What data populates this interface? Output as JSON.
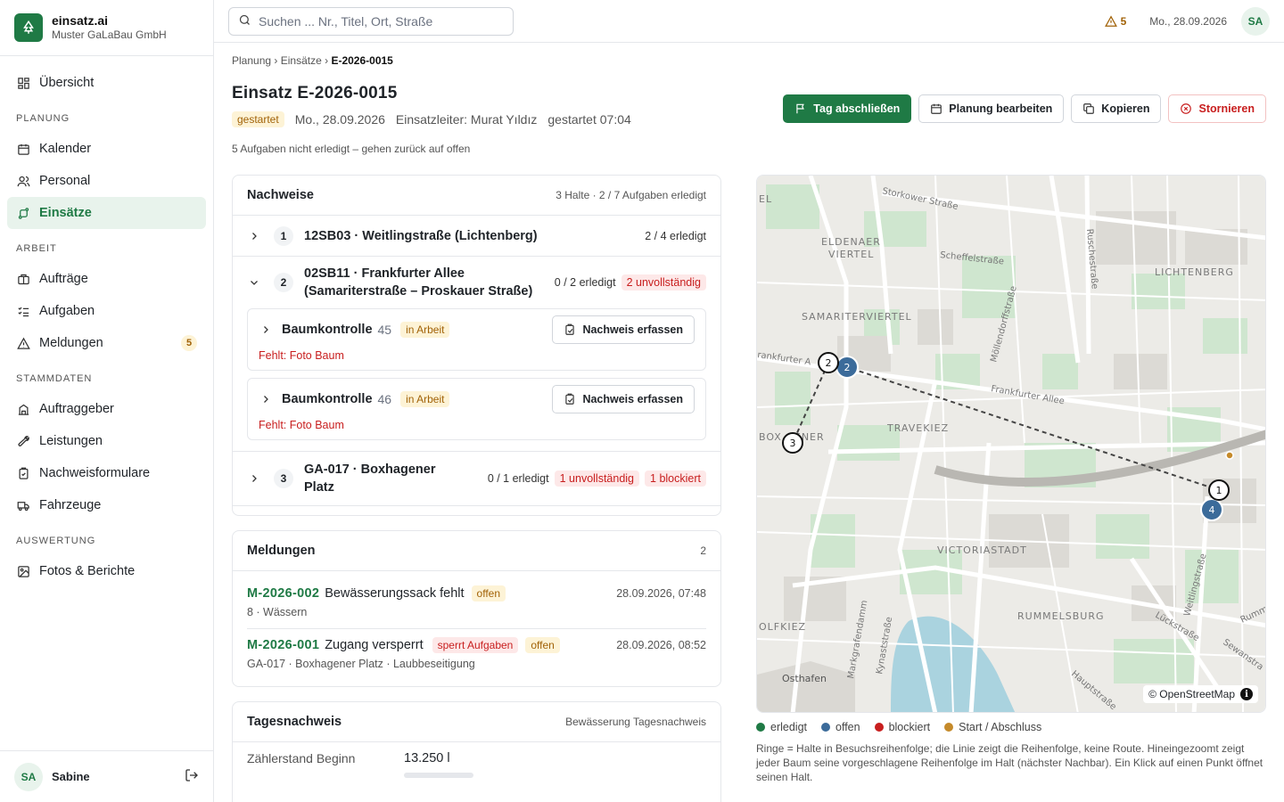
{
  "brand": {
    "name": "einsatz.ai",
    "company": "Muster GaLaBau GmbH"
  },
  "nav": {
    "overview": "Übersicht",
    "section_planung": "PLANUNG",
    "kalender": "Kalender",
    "personal": "Personal",
    "einsaetze": "Einsätze",
    "section_arbeit": "ARBEIT",
    "auftraege": "Aufträge",
    "aufgaben": "Aufgaben",
    "meldungen": "Meldungen",
    "meldungen_badge": "5",
    "section_stamm": "STAMMDATEN",
    "auftraggeber": "Auftraggeber",
    "leistungen": "Leistungen",
    "nachweisformulare": "Nachweisformulare",
    "fahrzeuge": "Fahrzeuge",
    "section_auswertung": "AUSWERTUNG",
    "fotos": "Fotos & Berichte"
  },
  "user": {
    "initials": "SA",
    "name": "Sabine"
  },
  "topbar": {
    "search_placeholder": "Suchen ... Nr., Titel, Ort, Straße",
    "warnings": "5",
    "date": "Mo., 28.09.2026",
    "initials": "SA"
  },
  "breadcrumb": {
    "a": "Planung",
    "b": "Einsätze",
    "c": "E-2026-0015",
    "sep": "›"
  },
  "header": {
    "title": "Einsatz E-2026-0015",
    "status": "gestartet",
    "date": "Mo., 28.09.2026",
    "leader": "Einsatzleiter: Murat Yıldız",
    "started": "gestartet 07:04",
    "note": "5 Aufgaben nicht erledigt – gehen zurück auf offen"
  },
  "actions": {
    "close_day": "Tag abschließen",
    "edit_plan": "Planung bearbeiten",
    "copy": "Kopieren",
    "cancel": "Stornieren"
  },
  "nachweise": {
    "title": "Nachweise",
    "summary": "3 Halte · 2 / 7 Aufgaben erledigt",
    "stops": [
      {
        "num": "1",
        "title": "12SB03 · Weitlingstraße (Lichtenberg)",
        "done": "2 / 4 erledigt"
      },
      {
        "num": "2",
        "title_l1": "02SB11 · Frankfurter Allee",
        "title_l2": "(Samariterstraße – Proskauer Straße)",
        "done": "0 / 2 erledigt",
        "incomplete": "2 unvollständig"
      },
      {
        "num": "3",
        "title_l1": "GA-017 · Boxhagener",
        "title_l2": "Platz",
        "done": "0 / 1 erledigt",
        "incomplete": "1 unvollständig",
        "blocked": "1 blockiert"
      }
    ],
    "tasks": [
      {
        "name": "Baumkontrolle",
        "num": "45",
        "status": "in Arbeit",
        "button": "Nachweis erfassen",
        "missing": "Fehlt: Foto Baum"
      },
      {
        "name": "Baumkontrolle",
        "num": "46",
        "status": "in Arbeit",
        "button": "Nachweis erfassen",
        "missing": "Fehlt: Foto Baum"
      }
    ]
  },
  "meldungen": {
    "title": "Meldungen",
    "count": "2",
    "items": [
      {
        "id": "M-2026-002",
        "text": "Bewässerungssack fehlt",
        "status": "offen",
        "time": "28.09.2026, 07:48",
        "sub": "8 · Wässern"
      },
      {
        "id": "M-2026-001",
        "text": "Zugang versperrt",
        "flag": "sperrt Aufgaben",
        "status": "offen",
        "time": "28.09.2026, 08:52",
        "sub": "GA-017 · Boxhagener Platz · Laubbeseitigung"
      }
    ]
  },
  "tagesnachweis": {
    "title": "Tagesnachweis",
    "sub": "Bewässerung Tagesnachweis",
    "label": "Zählerstand Beginn",
    "value": "13.250 l"
  },
  "map": {
    "labels": {
      "storkower": "Storkower Straße",
      "eldenaer1": "ELDENAER",
      "eldenaer2": "VIERTEL",
      "scheffel": "Scheffelstraße",
      "lichtenberg": "LICHTENBERG",
      "samariter": "SAMARITERVIERTEL",
      "frankfurter": "Frankfurter Allee",
      "frankfurter_l": "rankfurter A",
      "travekiez": "TRAVEKIEZ",
      "boxhagener": "BOX     GENER",
      "victoria": "VICTORIASTADT",
      "rummelsburg": "RUMMELSBURG",
      "olfkiez": "OLFKIEZ",
      "osthafen": "Osthafen",
      "weitling": "Weitlingstraße",
      "luecken": "Lückstraße",
      "haupt": "Hauptstraße",
      "kynast": "Kynaststraße",
      "markgrafen": "Markgrafendamm",
      "moellendorf": "Möllendorffstraße",
      "rusche": "Ruschestraße",
      "sewan": "Sewanstra",
      "rummel_r": "Rumme",
      "el": "EL"
    },
    "markers": [
      "1",
      "2",
      "3",
      "4"
    ],
    "attribution": "© OpenStreetMap",
    "info": "i"
  },
  "legend": {
    "done": "erledigt",
    "open": "offen",
    "blocked": "blockiert",
    "start": "Start / Abschluss"
  },
  "colors": {
    "done": "#1f7a45",
    "open": "#3b6b9a",
    "blocked": "#c81e1e",
    "start": "#c58a2a"
  },
  "map_note": "Ringe = Halte in Besuchsreihenfolge; die Linie zeigt die Reihenfolge, keine Route. Hineingezoomt zeigt jeder Baum seine vorgeschlagene Reihenfolge im Halt (nächster Nachbar). Ein Klick auf einen Punkt öffnet seinen Halt."
}
